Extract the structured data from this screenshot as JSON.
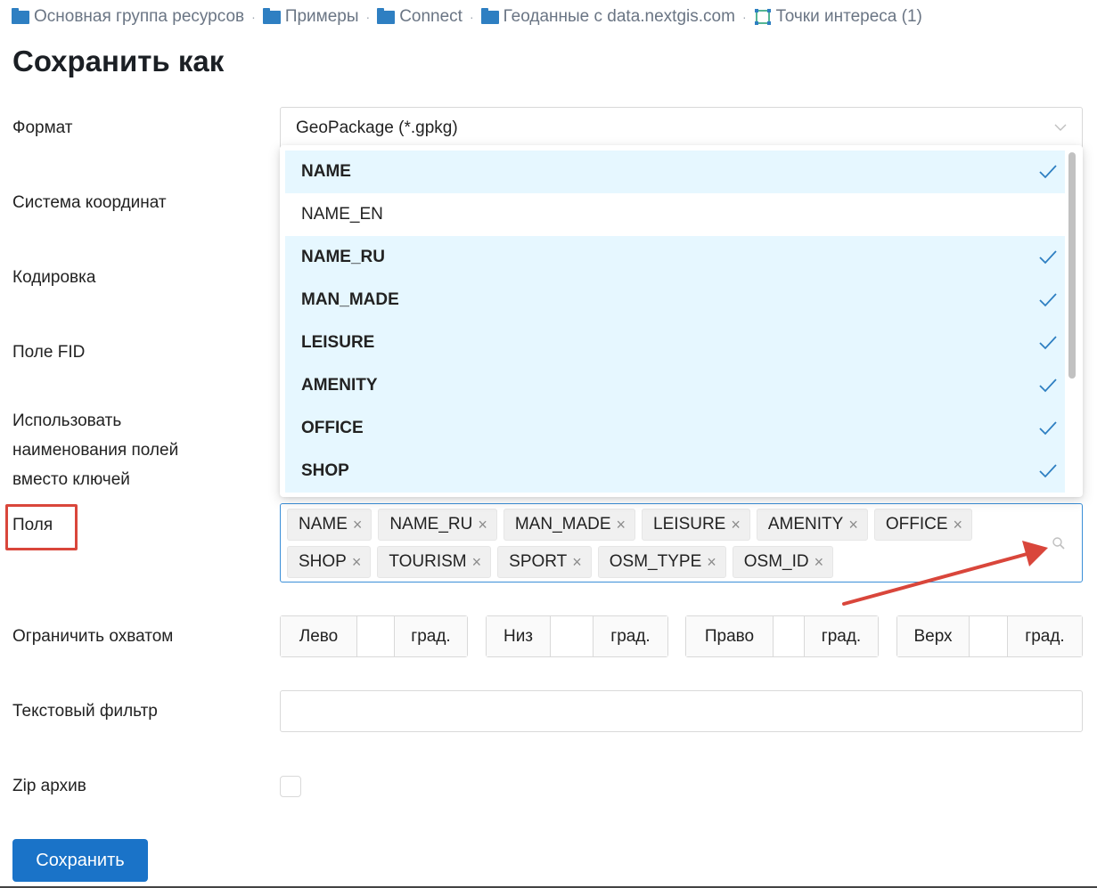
{
  "breadcrumb": [
    {
      "label": "Основная группа ресурсов",
      "icon": "folder-icon"
    },
    {
      "label": "Примеры",
      "icon": "folder-icon"
    },
    {
      "label": "Connect",
      "icon": "folder-icon"
    },
    {
      "label": "Геоданные с data.nextgis.com",
      "icon": "folder-icon"
    },
    {
      "label": "Точки интереса (1)",
      "icon": "vector-layer-icon"
    }
  ],
  "breadcrumb_separator": "·",
  "page_title": "Сохранить как",
  "labels": {
    "format": "Формат",
    "srs": "Система координат",
    "encoding": "Кодировка",
    "fid_field": "Поле FID",
    "use_display_name_1": "Использовать",
    "use_display_name_2": "наименования полей",
    "use_display_name_3": "вместо ключей",
    "fields": "Поля",
    "extent": "Ограничить охватом",
    "text_filter": "Текстовый фильтр",
    "zip": "Zip архив"
  },
  "format_select": {
    "value": "GeoPackage (*.gpkg)"
  },
  "dropdown_options": [
    {
      "label": "NAME",
      "selected": true
    },
    {
      "label": "NAME_EN",
      "selected": false
    },
    {
      "label": "NAME_RU",
      "selected": true
    },
    {
      "label": "MAN_MADE",
      "selected": true
    },
    {
      "label": "LEISURE",
      "selected": true
    },
    {
      "label": "AMENITY",
      "selected": true
    },
    {
      "label": "OFFICE",
      "selected": true
    },
    {
      "label": "SHOP",
      "selected": true
    }
  ],
  "tags": [
    "NAME",
    "NAME_RU",
    "MAN_MADE",
    "LEISURE",
    "AMENITY",
    "OFFICE",
    "SHOP",
    "TOURISM",
    "SPORT",
    "OSM_TYPE",
    "OSM_ID"
  ],
  "tag_remove_glyph": "×",
  "extent": [
    {
      "label": "Лево",
      "unit": "град."
    },
    {
      "label": "Низ",
      "unit": "град."
    },
    {
      "label": "Право",
      "unit": "град."
    },
    {
      "label": "Верх",
      "unit": "град."
    }
  ],
  "text_filter": {
    "value": ""
  },
  "zip_checked": false,
  "save_button": "Сохранить",
  "colors": {
    "accent": "#1a73c8",
    "selected_bg": "#e6f7ff",
    "check": "#2e7fc2",
    "highlight": "#d9463b"
  }
}
